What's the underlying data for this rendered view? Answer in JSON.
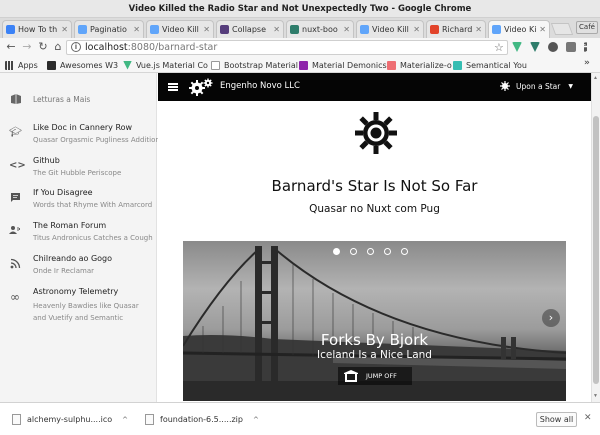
{
  "window": {
    "title": "Video Killed the Radio Star and Not Unexpectedly Two - Google Chrome",
    "close_label": "Café"
  },
  "tabs": [
    {
      "label": "How To th",
      "color": "#3b82f6"
    },
    {
      "label": "Paginatio",
      "color": "#60a5fa"
    },
    {
      "label": "Video Kill",
      "color": "#60a5fa"
    },
    {
      "label": "Collapse",
      "color": "#563d7c"
    },
    {
      "label": "nuxt-boo",
      "color": "#2e7d6b"
    },
    {
      "label": "Video Kill",
      "color": "#60a5fa"
    },
    {
      "label": "Richard (",
      "color": "#e2432a"
    },
    {
      "label": "Video Kil",
      "color": "#60a5fa"
    }
  ],
  "toolbar": {
    "back": "←",
    "forward": "→",
    "reload": "↻",
    "home": "⌂",
    "url_host": "localhost",
    "url_port": ":8080",
    "url_path": "/barnard-star"
  },
  "bookmarks": [
    {
      "label": "Apps",
      "icon": "apps-grid-icon",
      "color": "#444"
    },
    {
      "label": "Awesomes W3",
      "icon": "awesome-icon",
      "color": "#2b2b2b"
    },
    {
      "label": "Vue.js Material Co",
      "icon": "vue-icon",
      "color": "#41b883"
    },
    {
      "label": "Bootstrap Material",
      "icon": "doc-icon",
      "color": "#bdbdbd"
    },
    {
      "label": "Material Demonics",
      "icon": "material-icon",
      "color": "#8e24aa"
    },
    {
      "label": "Materialize-o",
      "icon": "materialize-icon",
      "color": "#ee6e73"
    },
    {
      "label": "Semantical You",
      "icon": "semantic-icon",
      "color": "#35bdb2"
    }
  ],
  "sidebar": {
    "header": "Letturas a Mais",
    "items": [
      {
        "title": "Like Doc in Cannery Row",
        "sub": "Quasar Orgasmic Pugliness Additional",
        "icon": "school-icon"
      },
      {
        "title": "Github",
        "sub": "The Git Hubble Periscope",
        "icon": "code-icon"
      },
      {
        "title": "If You Disagree",
        "sub": "Words that Rhyme With Amarcord",
        "icon": "chat-icon"
      },
      {
        "title": "The Roman Forum",
        "sub": "Titus Andronicus Catches a Cough",
        "icon": "forum-icon"
      },
      {
        "title": "Chilreando ao Gogo",
        "sub": "Onde Ir Reclamar",
        "icon": "rss-icon"
      },
      {
        "title": "Astronomy Telemetry",
        "sub": "Heavenly Bawdies like Quasar and Vuetify and Semantic",
        "icon": "infinity-icon"
      }
    ]
  },
  "appbar": {
    "brand": "Engenho Novo LLC",
    "user_menu": "Upon a Star"
  },
  "main": {
    "title": "Barnard's Star Is Not So Far",
    "subtitle": "Quasar no Nuxt com Pug",
    "carousel": {
      "slide_count": 5,
      "active_slide": 1,
      "caption_title": "Forks By Bjork",
      "caption_sub": "Iceland Is a Nice Land",
      "button": "JUMP OFF",
      "next": "›"
    }
  },
  "downloads": {
    "items": [
      {
        "name": "alchemy-sulphu....ico"
      },
      {
        "name": "foundation-6.5.....zip"
      }
    ],
    "show_all": "Show all",
    "close": "✕"
  }
}
